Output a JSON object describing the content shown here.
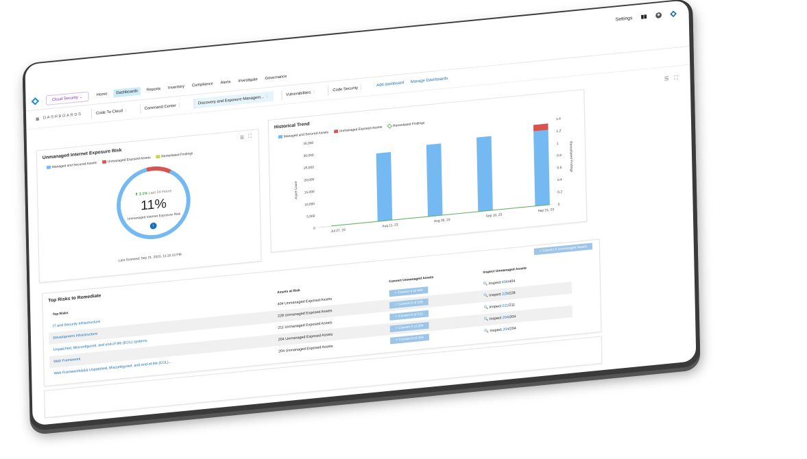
{
  "header": {
    "settings_label": "Settings"
  },
  "nav": {
    "product": "Cloud Security",
    "items": [
      "Home",
      "Dashboards",
      "Reports",
      "Inventory",
      "Compliance",
      "Alerts",
      "Investigate",
      "Governance"
    ],
    "active_index": 1
  },
  "dashboards": {
    "label": "DASHBOARDS",
    "tabs": [
      "Code To Cloud",
      "Command Center",
      "Discovery and Exposure Managem...",
      "Vulnerabilities",
      "Code Security"
    ],
    "active_index": 2,
    "add_link": "Add dashboard",
    "manage_link": "Manage Dashboards"
  },
  "risk_card": {
    "title": "Unmanaged Internet Exposure Risk",
    "legend": [
      "Managed and Secured Assets",
      "Unmanaged Exposed Assets",
      "Remediated Findings"
    ],
    "change": "1.1%",
    "change_period": "Last 24 Hours",
    "percent": "11%",
    "percent_value": 11,
    "subtitle": "Unmanaged Internet Exposure Risk",
    "last_scanned": "Last Scanned: Sep 21, 2023, 11:15:13 PM"
  },
  "trend_card": {
    "title": "Historical Trend",
    "legend": [
      "Managed and Secured Assets",
      "Unmanaged Exposed Assets",
      "Remediated Findings"
    ]
  },
  "chart_data": {
    "type": "bar",
    "title": "Historical Trend",
    "ylabel": "Asset Count",
    "y2label": "Remediated Findings",
    "ylim": [
      0,
      35000
    ],
    "y2lim": [
      0,
      1.4
    ],
    "y_ticks": [
      "0",
      "5,000",
      "10,000",
      "15,000",
      "20,000",
      "25,000",
      "30,000",
      "35,000"
    ],
    "y2_ticks": [
      "0",
      "0.2",
      "0.4",
      "0.6",
      "0.8",
      "1",
      "1.2",
      "1.4"
    ],
    "x_ticks": [
      "Jul 27, 23",
      "Aug 11, 23",
      "Aug 26, 23",
      "Sep 10, 23",
      "Sep 21, 23"
    ],
    "bars": [
      {
        "x": "Aug 4",
        "managed": 28000,
        "unmanaged": 0
      },
      {
        "x": "Aug 19",
        "managed": 29500,
        "unmanaged": 0
      },
      {
        "x": "Sep 3",
        "managed": 30500,
        "unmanaged": 0
      },
      {
        "x": "Sep 21",
        "managed": 30800,
        "unmanaged": 2600
      }
    ],
    "remediated_line": "flat at 0",
    "colors": {
      "managed": "#74b9f2",
      "unmanaged": "#d9534f",
      "remediated": "#5cb85c"
    }
  },
  "risks_card": {
    "title": "Top Risks to Remediate",
    "convert_all_button": "Convert 5 Unmanaged Assets",
    "columns": [
      "Top Risks",
      "Assets at Risk",
      "Convert Unmanaged Assets",
      "Inspect Unmanaged Assets"
    ],
    "rows": [
      {
        "risk": "IT and Security Infrastructure",
        "assets": "404 Unmanaged Exposed Assets",
        "convert": "Convert 0 of 404",
        "inspect_prefix": "Inspect ",
        "inspect_link": "404",
        "inspect_suffix": "/404"
      },
      {
        "risk": "Development Infrastructure",
        "assets": "228 Unmanaged Exposed Assets",
        "convert": "Convert 0 of 228",
        "inspect_prefix": "Inspect ",
        "inspect_link": "228",
        "inspect_suffix": "/228"
      },
      {
        "risk": "Unpatched, Misconfigured, and end-of-life (EOL) systems",
        "assets": "211 Unmanaged Exposed Assets",
        "convert": "Convert 0 of 211",
        "inspect_prefix": "Inspect ",
        "inspect_link": "211",
        "inspect_suffix": "/211"
      },
      {
        "risk": "Web Framework",
        "assets": "204 Unmanaged Exposed Assets",
        "convert": "Convert 0 of 204",
        "inspect_prefix": "Inspect ",
        "inspect_link": "204",
        "inspect_suffix": "/204"
      },
      {
        "risk": "Web Framework&&& Unpatched, Misconfigured, and end-of-life (EOL)...",
        "assets": "204 Unmanaged Exposed Assets",
        "convert": "Convert 0 of 204",
        "inspect_prefix": "Inspect ",
        "inspect_link": "204",
        "inspect_suffix": "/204"
      }
    ]
  }
}
